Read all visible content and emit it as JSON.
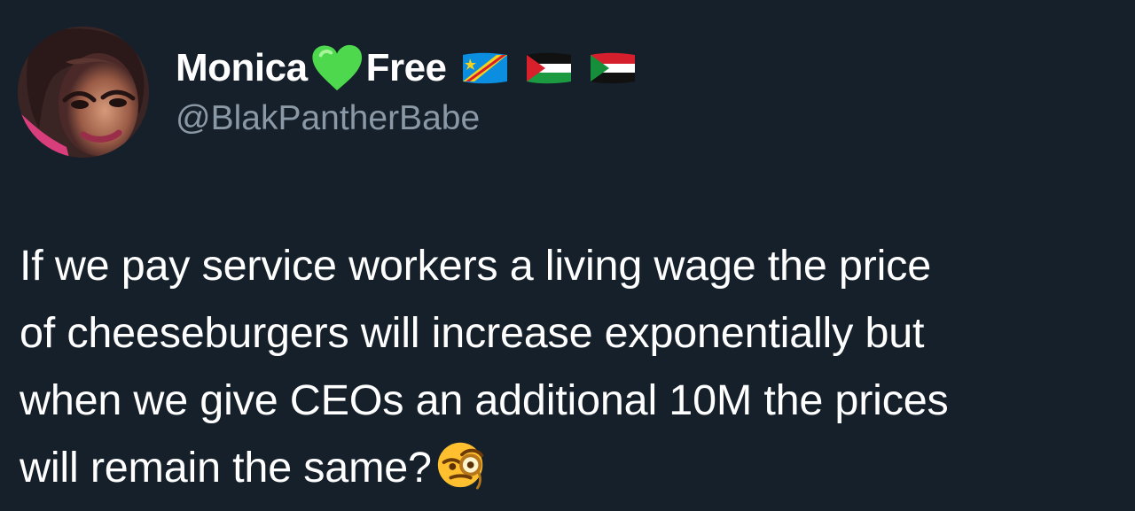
{
  "profile": {
    "display_name_first": "Monica",
    "display_name_second": "Free",
    "handle": "@BlakPantherBabe"
  },
  "tweet": {
    "lines": [
      "If we pay service workers a living wage the price",
      "of cheeseburgers will increase exponentially but",
      "when we give CEOs an additional 10M  the prices",
      "will remain the same?"
    ]
  },
  "icons": {
    "heart": "green-heart-icon",
    "flag_1": "flag-drc-icon",
    "flag_2": "flag-palestine-icon",
    "flag_3": "flag-sudan-icon",
    "emoji": "face-with-monocle-emoji"
  },
  "colors": {
    "background": "#15202b",
    "text": "#ffffff",
    "secondary_text": "#8b98a5",
    "heart": "#4ed84d"
  }
}
